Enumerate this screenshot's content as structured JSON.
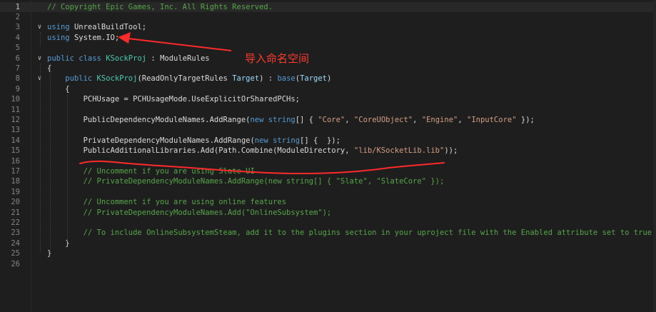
{
  "editor": {
    "lines": [
      {
        "num": "1",
        "current": true,
        "fold": "",
        "tokens": [
          {
            "t": "// Copyright Epic Games, Inc. All Rights Reserved.",
            "c": "comment"
          }
        ]
      },
      {
        "num": "2",
        "fold": "",
        "tokens": []
      },
      {
        "num": "3",
        "fold": "∨",
        "tokens": [
          {
            "t": "using ",
            "c": "keyword"
          },
          {
            "t": "UnrealBuildTool;",
            "c": "plain"
          }
        ]
      },
      {
        "num": "4",
        "fold": "",
        "tokens": [
          {
            "t": "using ",
            "c": "keyword"
          },
          {
            "t": "System.IO;",
            "c": "plain"
          }
        ]
      },
      {
        "num": "5",
        "fold": "",
        "tokens": []
      },
      {
        "num": "6",
        "fold": "∨",
        "tokens": [
          {
            "t": "public ",
            "c": "keyword"
          },
          {
            "t": "class ",
            "c": "keyword"
          },
          {
            "t": "KSockProj",
            "c": "type"
          },
          {
            "t": " : ",
            "c": "plain"
          },
          {
            "t": "ModuleRules",
            "c": "plain"
          }
        ]
      },
      {
        "num": "7",
        "fold": "",
        "tokens": [
          {
            "t": "{",
            "c": "plain"
          }
        ]
      },
      {
        "num": "8",
        "fold": "∨",
        "tokens": [
          {
            "t": "    public ",
            "c": "keyword"
          },
          {
            "t": "KSockProj",
            "c": "type"
          },
          {
            "t": "(ReadOnlyTargetRules ",
            "c": "plain"
          },
          {
            "t": "Target",
            "c": "param"
          },
          {
            "t": ") : ",
            "c": "plain"
          },
          {
            "t": "base",
            "c": "keyword"
          },
          {
            "t": "(",
            "c": "plain"
          },
          {
            "t": "Target",
            "c": "param"
          },
          {
            "t": ")",
            "c": "plain"
          }
        ]
      },
      {
        "num": "9",
        "fold": "",
        "tokens": [
          {
            "t": "    {",
            "c": "plain"
          }
        ]
      },
      {
        "num": "10",
        "fold": "",
        "tokens": [
          {
            "t": "        PCHUsage = PCHUsageMode.UseExplicitOrSharedPCHs;",
            "c": "plain"
          }
        ]
      },
      {
        "num": "11",
        "fold": "",
        "tokens": []
      },
      {
        "num": "12",
        "fold": "",
        "tokens": [
          {
            "t": "        PublicDependencyModuleNames.AddRange(",
            "c": "plain"
          },
          {
            "t": "new ",
            "c": "keyword"
          },
          {
            "t": "string",
            "c": "keyword"
          },
          {
            "t": "[] { ",
            "c": "plain"
          },
          {
            "t": "\"Core\"",
            "c": "string"
          },
          {
            "t": ", ",
            "c": "plain"
          },
          {
            "t": "\"CoreUObject\"",
            "c": "string"
          },
          {
            "t": ", ",
            "c": "plain"
          },
          {
            "t": "\"Engine\"",
            "c": "string"
          },
          {
            "t": ", ",
            "c": "plain"
          },
          {
            "t": "\"InputCore\"",
            "c": "string"
          },
          {
            "t": " });",
            "c": "plain"
          }
        ]
      },
      {
        "num": "13",
        "fold": "",
        "tokens": []
      },
      {
        "num": "14",
        "fold": "",
        "tokens": [
          {
            "t": "        PrivateDependencyModuleNames.AddRange(",
            "c": "plain"
          },
          {
            "t": "new ",
            "c": "keyword"
          },
          {
            "t": "string",
            "c": "keyword"
          },
          {
            "t": "[] {  });",
            "c": "plain"
          }
        ]
      },
      {
        "num": "15",
        "fold": "",
        "tokens": [
          {
            "t": "        PublicAdditionalLibraries.Add(Path.Combine(ModuleDirectory, ",
            "c": "plain"
          },
          {
            "t": "\"lib/KSocketLib.lib\"",
            "c": "string"
          },
          {
            "t": "));",
            "c": "plain"
          }
        ]
      },
      {
        "num": "16",
        "fold": "",
        "tokens": []
      },
      {
        "num": "17",
        "fold": "",
        "tokens": [
          {
            "t": "        // Uncomment if you are using Slate UI",
            "c": "comment"
          }
        ]
      },
      {
        "num": "18",
        "fold": "",
        "tokens": [
          {
            "t": "        // PrivateDependencyModuleNames.AddRange(new string[] { \"Slate\", \"SlateCore\" });",
            "c": "comment"
          }
        ]
      },
      {
        "num": "19",
        "fold": "",
        "tokens": []
      },
      {
        "num": "20",
        "fold": "",
        "tokens": [
          {
            "t": "        // Uncomment if you are using online features",
            "c": "comment"
          }
        ]
      },
      {
        "num": "21",
        "fold": "",
        "tokens": [
          {
            "t": "        // PrivateDependencyModuleNames.Add(\"OnlineSubsystem\");",
            "c": "comment"
          }
        ]
      },
      {
        "num": "22",
        "fold": "",
        "tokens": []
      },
      {
        "num": "23",
        "fold": "",
        "tokens": [
          {
            "t": "        // To include OnlineSubsystemSteam, add it to the plugins section in your uproject file with the Enabled attribute set to true",
            "c": "comment"
          }
        ]
      },
      {
        "num": "24",
        "fold": "",
        "tokens": [
          {
            "t": "    }",
            "c": "plain"
          }
        ]
      },
      {
        "num": "25",
        "fold": "",
        "tokens": [
          {
            "t": "}",
            "c": "plain"
          }
        ]
      },
      {
        "num": "26",
        "fold": "",
        "tokens": []
      }
    ]
  },
  "annotation": {
    "text": "导入命名空间",
    "color": "#ff3b30"
  },
  "colors": {
    "background": "#1e1e1e",
    "keyword": "#569cd6",
    "type": "#4ec9b0",
    "string": "#d69d85",
    "comment": "#57a64a"
  }
}
